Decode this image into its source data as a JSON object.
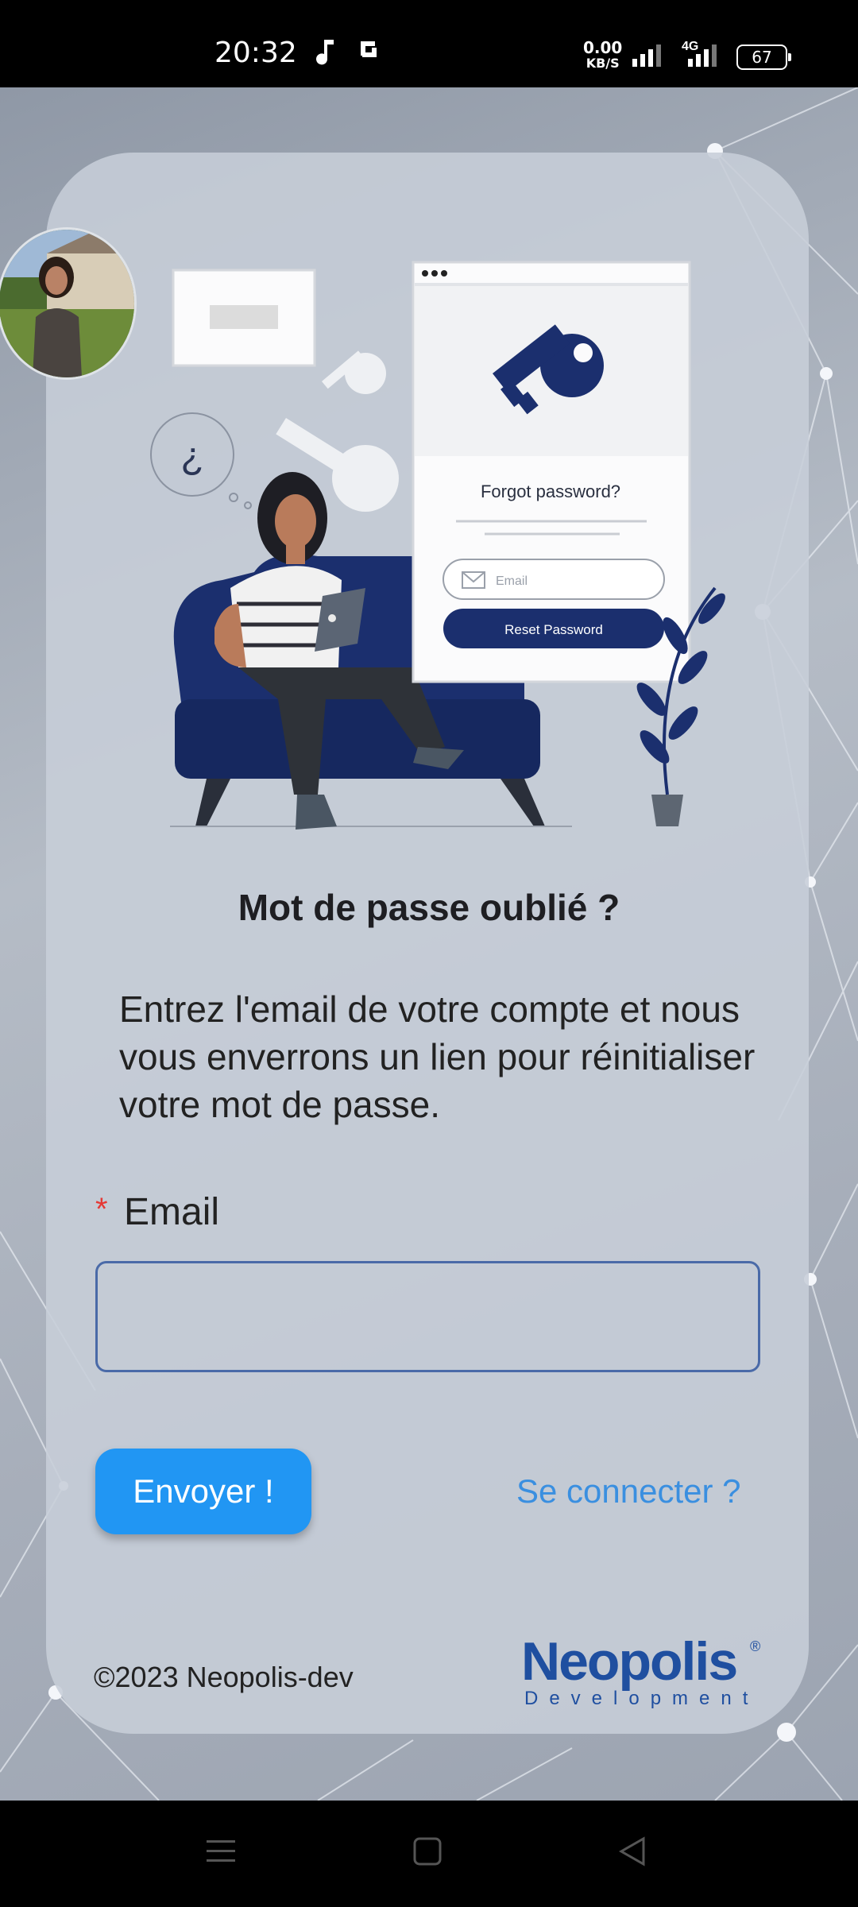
{
  "status_bar": {
    "time": "20:32",
    "net_speed_value": "0.00",
    "net_speed_unit": "KB/S",
    "network_type": "4G",
    "battery": "67"
  },
  "illustration": {
    "card_heading": "Forgot password?",
    "email_placeholder": "Email",
    "button_label": "Reset Password",
    "thought_symbol": "¿"
  },
  "form": {
    "title": "Mot de passe oublié ?",
    "description": "Entrez l'email de votre compte et nous vous enverrons un lien pour réinitialiser votre mot de passe.",
    "required_marker": "*",
    "email_label": "Email",
    "email_value": "",
    "submit_label": "Envoyer !",
    "login_link": "Se connecter ?"
  },
  "footer": {
    "copyright": "©2023 Neopolis-dev",
    "logo_word": "Neopolis",
    "logo_sub": "Development",
    "logo_reg": "®"
  },
  "colors": {
    "accent": "#2196f3",
    "brand": "#1f4fa0",
    "required": "#e53935",
    "illustration_navy": "#1b2f6e"
  }
}
